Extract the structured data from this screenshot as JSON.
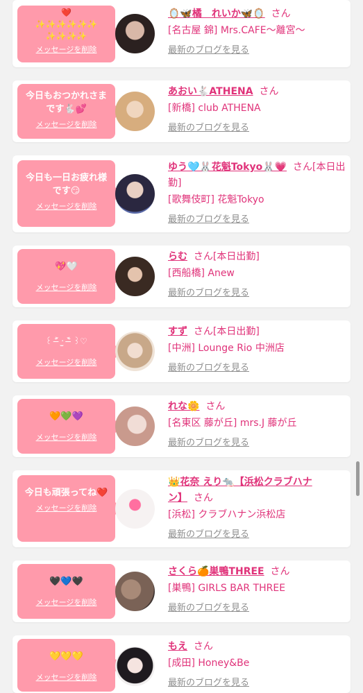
{
  "colors": {
    "accent": "#e0337a",
    "bubble": "#ff9aab",
    "link_gray": "#8f8f8f",
    "bg": "#f2f2f2"
  },
  "cards": [
    {
      "bubble_text": "❤️\n✨✨✨✨✨✨\n✨✨✨✨",
      "delete_label": "メッセージを削除",
      "name": "🪞🦋橘　れいか🦋🪞",
      "suffix": "さん",
      "shop": "[名古屋 錦] Mrs.CAFE〜離宮〜",
      "blog_label": "最新のブログを見る",
      "avatar_colors": [
        "#2b2120",
        "#d8b8a8"
      ]
    },
    {
      "bubble_text": "今日もおつかれさまです🐇💕",
      "delete_label": "メッセージを削除",
      "name": "あおい🐇ATHENA",
      "suffix": "さん",
      "shop": "[新橋] club ATHENA",
      "blog_label": "最新のブログを見る",
      "avatar_colors": [
        "#e7c49a",
        "#b07a55"
      ]
    },
    {
      "bubble_text": "今日も一日お疲れ様です😏",
      "delete_label": "メッセージを削除",
      "name": "ゆう🩵🐰花魁Tokyo🐰💗",
      "suffix": "さん[本日出勤]",
      "shop": "[歌舞伎町] 花魁Tokyo",
      "blog_label": "最新のブログを見る",
      "avatar_colors": [
        "#2a2740",
        "#5a6aa8"
      ]
    },
    {
      "bubble_text": "💖🤍",
      "delete_label": "メッセージを削除",
      "name": "らむ",
      "suffix": "さん[本日出勤]",
      "shop": "[西船橋] Anew",
      "blog_label": "最新のブログを見る",
      "avatar_colors": [
        "#3a2a22",
        "#c9a183"
      ]
    },
    {
      "bubble_text": "꒰ ˃̶᷄ ‧̫ ˂̶᷅ ꒱♡",
      "delete_label": "メッセージを削除",
      "name": "すず",
      "suffix": "さん[本日出勤]",
      "shop": "[中洲] Lounge Rio 中洲店",
      "blog_label": "最新のブログを見る",
      "avatar_colors": [
        "#c8a889",
        "#efe3d7"
      ]
    },
    {
      "bubble_text": "🧡💚💜",
      "delete_label": "メッセージを削除",
      "name": "れな🌼",
      "suffix": "さん",
      "shop": "[名東区 藤が丘] mrs.J 藤が丘",
      "blog_label": "最新のブログを見る",
      "avatar_colors": [
        "#c99a8d",
        "#f1ddd6"
      ]
    },
    {
      "bubble_text": "今日も頑張ってね❤️",
      "delete_label": "メッセージを削除",
      "name": "👑花奈 えり🐀【浜松クラブハナン】",
      "suffix": "さん",
      "shop": "[浜松] クラブハナン浜松店",
      "blog_label": "最新のブログを見る",
      "avatar_colors": [
        "#f6f2f2",
        "#e3c5c5"
      ]
    },
    {
      "bubble_text": "🖤💙🖤",
      "delete_label": "メッセージを削除",
      "name": "さくら🍊巣鴨THREE",
      "suffix": "さん",
      "shop": "[巣鴨] GIRLS BAR THREE",
      "blog_label": "最新のブログを見る",
      "avatar_colors": [
        "#7a6256",
        "#3d3330"
      ]
    },
    {
      "bubble_text": "💛💛💛",
      "delete_label": "メッセージを削除",
      "name": "もえ",
      "suffix": "さん",
      "shop": "[成田] Honey&Be",
      "blog_label": "最新のブログを見る",
      "avatar_colors": [
        "#f1efef",
        "#1e1a1f"
      ]
    }
  ]
}
